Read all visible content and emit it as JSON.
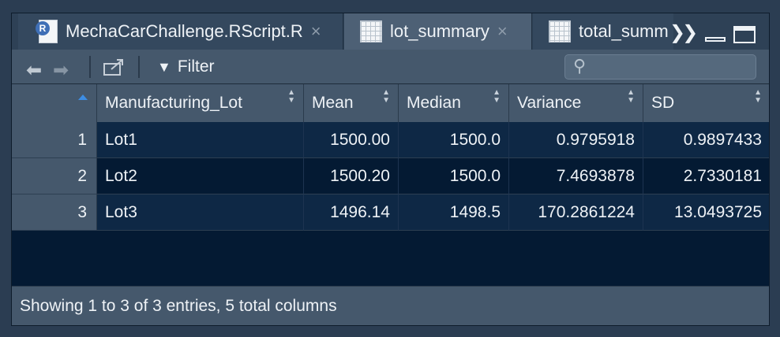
{
  "tabs": [
    {
      "label": "MechaCarChallenge.RScript.R",
      "icon": "r-script-icon",
      "close": "×"
    },
    {
      "label": "lot_summary",
      "icon": "table-icon",
      "close": "×",
      "active": true
    },
    {
      "label": "total_summ",
      "icon": "table-icon"
    }
  ],
  "tab_overflow": "»",
  "toolbar": {
    "back": "back-arrow-icon",
    "forward": "forward-arrow-icon",
    "popout": "popout-icon",
    "filter_label": "Filter",
    "search_placeholder": ""
  },
  "table": {
    "columns": [
      "Manufacturing_Lot",
      "Mean",
      "Median",
      "Variance",
      "SD"
    ],
    "rows": [
      {
        "index": "1",
        "cells": [
          "Lot1",
          "1500.00",
          "1500.0",
          "0.9795918",
          "0.9897433"
        ]
      },
      {
        "index": "2",
        "cells": [
          "Lot2",
          "1500.20",
          "1500.0",
          "7.4693878",
          "2.7330181"
        ]
      },
      {
        "index": "3",
        "cells": [
          "Lot3",
          "1496.14",
          "1498.5",
          "170.2861224",
          "13.0493725"
        ]
      }
    ]
  },
  "status": "Showing 1 to 3 of 3 entries, 5 total columns",
  "colors": {
    "background": "#041a33",
    "header": "#45586c",
    "row_alt": "#0e2845",
    "sort_accent": "#3d8de3"
  }
}
